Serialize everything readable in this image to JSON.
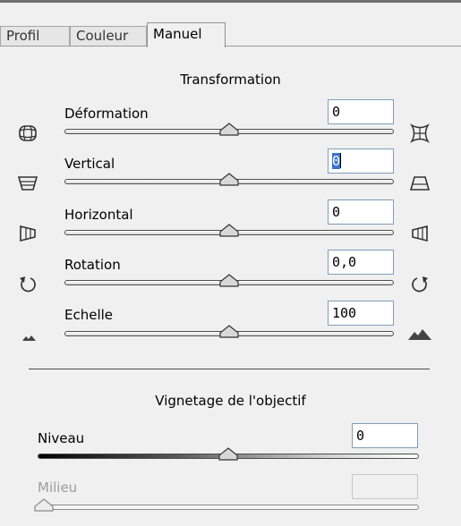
{
  "tabs": [
    {
      "label": "Profil"
    },
    {
      "label": "Couleur"
    },
    {
      "label": "Manuel",
      "active": true
    }
  ],
  "transformation": {
    "title": "Transformation",
    "sliders": [
      {
        "label": "Déformation",
        "value": "0",
        "position": 0.5,
        "left_icon": "barrel-distortion-icon",
        "right_icon": "pincushion-distortion-icon"
      },
      {
        "label": "Vertical",
        "value": "0",
        "position": 0.5,
        "focused": true,
        "left_icon": "vertical-perspective-narrow-bottom-icon",
        "right_icon": "vertical-perspective-narrow-top-icon"
      },
      {
        "label": "Horizontal",
        "value": "0",
        "position": 0.5,
        "left_icon": "horizontal-perspective-left-icon",
        "right_icon": "horizontal-perspective-right-icon"
      },
      {
        "label": "Rotation",
        "value": "0,0",
        "position": 0.5,
        "left_icon": "rotate-counterclockwise-icon",
        "right_icon": "rotate-clockwise-icon"
      },
      {
        "label": "Echelle",
        "value": "100",
        "position": 0.5,
        "left_icon": "scale-small-mountains-icon",
        "right_icon": "scale-large-mountains-icon"
      }
    ]
  },
  "vignetting": {
    "title": "Vignetage de l'objectif",
    "amount": {
      "label": "Niveau",
      "value": "0",
      "position": 0.5
    },
    "midpoint": {
      "label": "Milieu",
      "value": "",
      "position": 0.0,
      "disabled": true
    }
  },
  "colors": {
    "panel_bg": "#f0f0f0",
    "selection": "#3a74d1",
    "field_border": "#7f9db9",
    "disabled_text": "#9c9c9c"
  }
}
